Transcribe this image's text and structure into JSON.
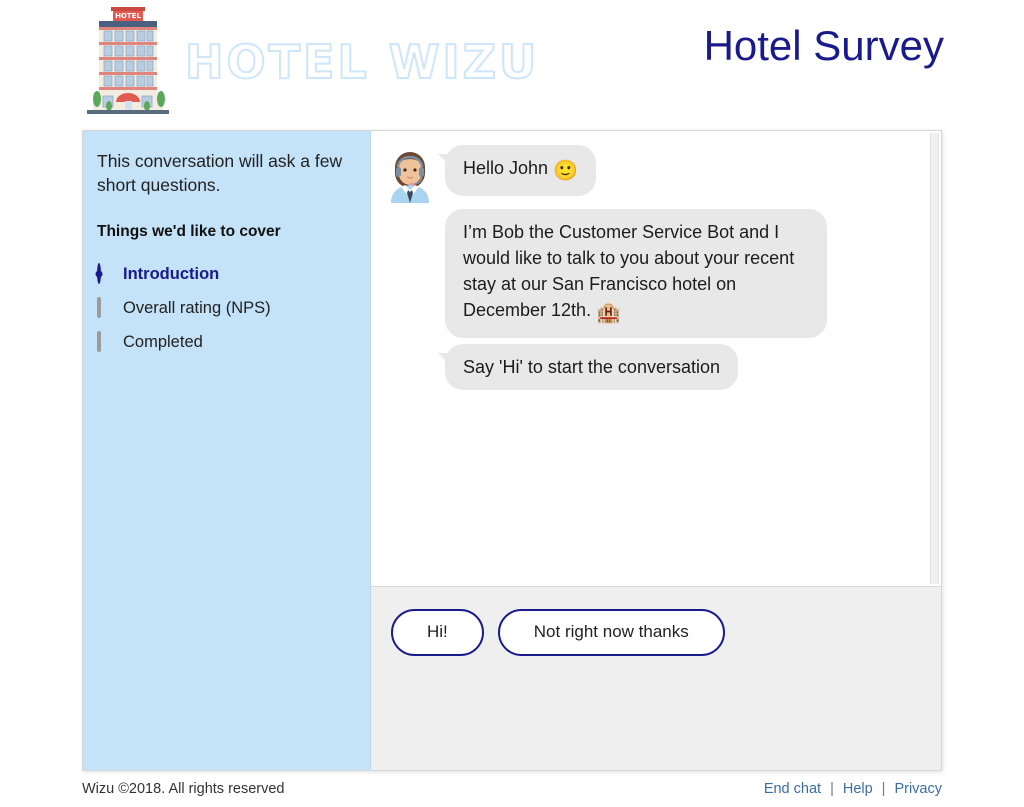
{
  "header": {
    "logo_text": "HOTEL WIZU",
    "logo_icon": "hotel-building-icon",
    "title": "Hotel Survey"
  },
  "sidebar": {
    "intro": "This conversation will ask a few short questions.",
    "heading": "Things we'd like to cover",
    "steps": [
      {
        "label": "Introduction",
        "state": "active",
        "icon": "radio-filled-icon"
      },
      {
        "label": "Overall rating (NPS)",
        "state": "pending",
        "icon": "square-outline-icon"
      },
      {
        "label": "Completed",
        "state": "pending",
        "icon": "square-outline-icon"
      }
    ]
  },
  "chat": {
    "avatar_icon": "agent-avatar-icon",
    "messages": [
      {
        "text": "Hello John ",
        "emoji": "🙂",
        "has_avatar": true,
        "has_tail": true
      },
      {
        "text": "I’m Bob the Customer Service Bot and I would like to talk to you about your recent stay at our San Francisco hotel on December 12th. ",
        "emoji": "🏨",
        "has_avatar": false,
        "has_tail": false
      },
      {
        "text": "Say 'Hi' to start the conversation",
        "emoji": "",
        "has_avatar": false,
        "has_tail": true
      }
    ],
    "replies": [
      {
        "label": "Hi!"
      },
      {
        "label": "Not right now thanks"
      }
    ]
  },
  "footer": {
    "copyright": "Wizu ©2018. All rights reserved",
    "links": [
      {
        "label": "End chat"
      },
      {
        "label": "Help"
      },
      {
        "label": "Privacy"
      }
    ],
    "separator": "|"
  },
  "colors": {
    "brand_navy": "#1a1a8c",
    "sidebar_blue": "#c4e2f8",
    "bubble_gray": "#e8e8e8",
    "panel_gray": "#efefef",
    "link_blue": "#3a6ea5"
  }
}
